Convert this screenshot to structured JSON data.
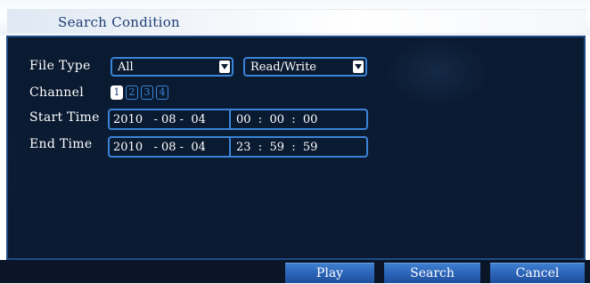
{
  "dialog": {
    "title": "Search Condition"
  },
  "form": {
    "file_type_label": "File Type",
    "file_type_value": "All",
    "mode_value": "Read/Write",
    "channel_label": "Channel",
    "channels": [
      {
        "label": "1",
        "selected": true
      },
      {
        "label": "2",
        "selected": false
      },
      {
        "label": "3",
        "selected": false
      },
      {
        "label": "4",
        "selected": false
      }
    ],
    "start_time_label": "Start Time",
    "start_date": "2010   - 08 -  04",
    "start_time": "00  :  00  :  00",
    "end_time_label": "End Time",
    "end_date": "2010   - 08 -  04",
    "end_time": "23  :  59  :  59"
  },
  "buttons": {
    "play": "Play",
    "search": "Search",
    "cancel": "Cancel"
  },
  "colors": {
    "panel_bg": "#0b1b33",
    "accent_border": "#3a84d8",
    "button_blue": "#2b64b8",
    "title_text": "#1e3c73"
  },
  "icons": {
    "dropdown": "chevron-down-icon"
  }
}
